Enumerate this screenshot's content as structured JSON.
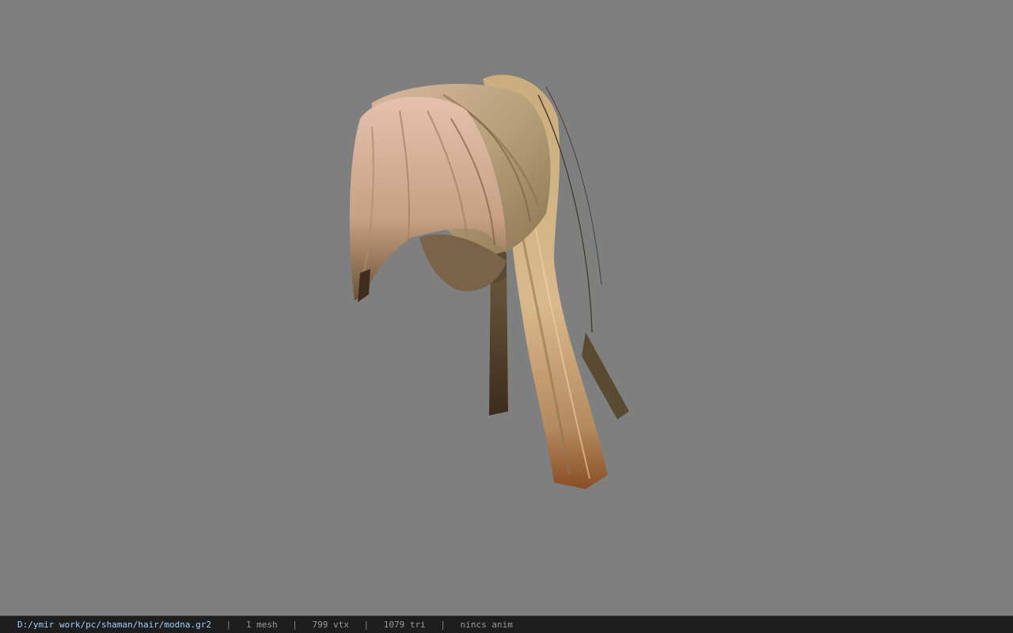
{
  "viewer": {
    "background_color": "#7f7f7f",
    "model_icon": "hair-mesh-icon"
  },
  "status": {
    "path": "D:/ymir work/pc/shaman/hair/modna.gr2",
    "separator": "|",
    "mesh": "1 mesh",
    "vertices": "799 vtx",
    "triangles": "1079 tri",
    "anim": "nincs anim"
  }
}
